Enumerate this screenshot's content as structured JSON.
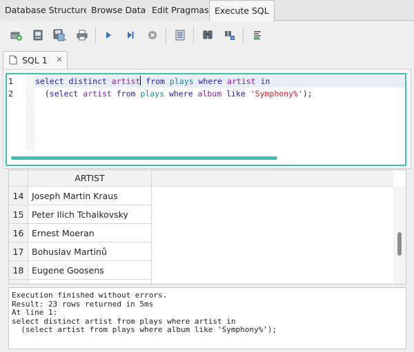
{
  "top_tabs": [
    {
      "label": "Database Structure",
      "active": false
    },
    {
      "label": "Browse Data",
      "active": false
    },
    {
      "label": "Edit Pragmas",
      "active": false
    },
    {
      "label": "Execute SQL",
      "active": true
    }
  ],
  "toolbar": {
    "buttons": [
      {
        "icon": "open-tab-icon"
      },
      {
        "icon": "open-sql-file-icon"
      },
      {
        "icon": "save-sql-file-icon"
      },
      {
        "icon": "print-icon"
      },
      {
        "icon": "execute-all-icon"
      },
      {
        "icon": "execute-current-line-icon"
      },
      {
        "icon": "stop-execution-icon"
      },
      {
        "icon": "save-results-icon"
      },
      {
        "icon": "find-text-icon"
      },
      {
        "icon": "find-replace-icon"
      },
      {
        "icon": "comment-block-icon"
      }
    ]
  },
  "editor_tab": {
    "label": "SQL 1",
    "close_glyph": "×"
  },
  "editor": {
    "line_numbers": [
      "1",
      "2"
    ],
    "line1": {
      "kw1": "select distinct",
      "id1": "artist",
      "kw2": "from",
      "tb1": "plays",
      "kw3": "where",
      "id2": "artist",
      "kw4": "in"
    },
    "line2": {
      "pl1": "  (",
      "kw1": "select",
      "id1": "artist",
      "kw2": "from",
      "tb1": "plays",
      "kw3": "where",
      "id2": "album",
      "kw4": "like",
      "str1": "'Symphony%'",
      "pl2": ");"
    }
  },
  "results": {
    "column_header": "ARTIST",
    "rows": [
      {
        "num": "14",
        "artist": "Joseph Martin Kraus"
      },
      {
        "num": "15",
        "artist": "Peter Ilich Tchaikovsky"
      },
      {
        "num": "16",
        "artist": "Ernest Moeran"
      },
      {
        "num": "17",
        "artist": "Bohuslav Martinů"
      },
      {
        "num": "18",
        "artist": "Eugene Goosens"
      }
    ]
  },
  "log": {
    "lines": [
      "Execution finished without errors.",
      "Result: 23 rows returned in 5ms",
      "At line 1:",
      "select distinct artist from plays where artist in",
      "  (select artist from plays where album like 'Symphony%');"
    ]
  },
  "colors": {
    "accent_teal": "#3fc1ad",
    "keyword_blue": "#1f1fa8",
    "identifier_purple": "#8c1fa5",
    "table_teal": "#138c8c",
    "string_red": "#d4172b"
  }
}
